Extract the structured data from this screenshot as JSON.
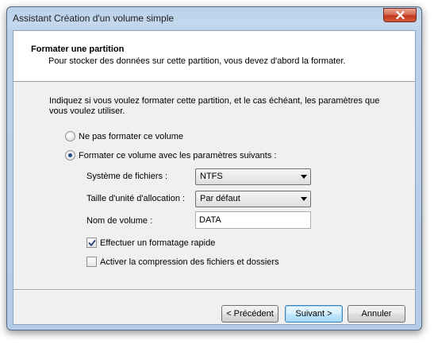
{
  "window": {
    "title": "Assistant Création d'un volume simple"
  },
  "header": {
    "title": "Formater une partition",
    "subtitle": "Pour stocker des données sur cette partition, vous devez d'abord la formater."
  },
  "intro_text": "Indiquez si vous voulez formater cette partition, et le cas échéant, les paramètres que vous voulez utiliser.",
  "options": {
    "no_format": {
      "label": "Ne pas formater ce volume",
      "selected": false
    },
    "format": {
      "label": "Formater ce volume avec les paramètres suivants :",
      "selected": true
    }
  },
  "fields": {
    "filesystem": {
      "label": "Système de fichiers :",
      "value": "NTFS"
    },
    "allocation": {
      "label": "Taille d'unité d'allocation :",
      "value": "Par défaut"
    },
    "volume_name": {
      "label": "Nom de volume :",
      "value": "DATA"
    }
  },
  "checkboxes": {
    "quick_format": {
      "label": "Effectuer un formatage rapide",
      "checked": true
    },
    "compression": {
      "label": "Activer la compression des fichiers et dossiers",
      "checked": false
    }
  },
  "buttons": {
    "back": "< Précédent",
    "next": "Suivant >",
    "cancel": "Annuler"
  },
  "icons": {
    "close": "close-icon",
    "dropdown": "chevron-down-icon",
    "check": "checkmark-icon"
  },
  "colors": {
    "accent": "#3c7fb1",
    "close_button": "#c2361c",
    "frame": "#b9d1ea"
  }
}
